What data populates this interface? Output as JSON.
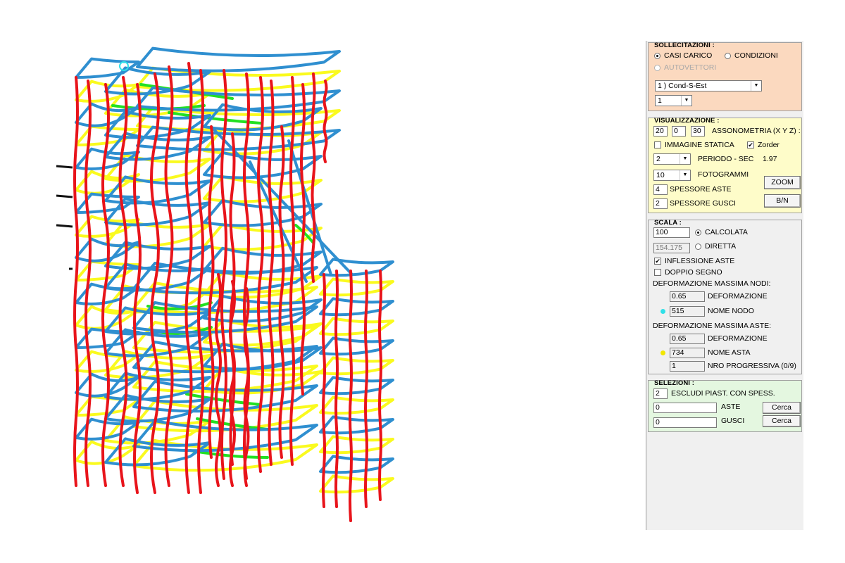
{
  "panel": {
    "sollecitazioni": {
      "title": "SOLLECITAZIONI :",
      "casi_carico": "CASI CARICO",
      "condizioni": "CONDIZIONI",
      "autovettori": "AUTOVETTORI",
      "load_case": "1 ) Cond-S-Est",
      "mode": "1"
    },
    "visualizzazione": {
      "title": "VISUALIZZAZIONE :",
      "ax": "20",
      "ay": "0",
      "az": "30",
      "assonometria": "ASSONOMETRIA (X Y Z) :",
      "immagine_statica": "IMMAGINE STATICA",
      "zorder": "Zorder",
      "periodo_value": "2",
      "periodo_label": "PERIODO - SEC",
      "periodo_sec": "1.97",
      "fotogrammi_value": "10",
      "fotogrammi_label": "FOTOGRAMMI",
      "spessore_aste_value": "4",
      "spessore_aste_label": "SPESSORE ASTE",
      "spessore_gusci_value": "2",
      "spessore_gusci_label": "SPESSORE GUSCI",
      "zoom": "ZOOM",
      "bn": "B/N"
    },
    "scala": {
      "title": "SCALA :",
      "calcolata_value": "100",
      "calcolata": "CALCOLATA",
      "diretta_value": "154.175",
      "diretta": "DIRETTA",
      "inflessione_aste": "INFLESSIONE ASTE",
      "doppio_segno": "DOPPIO SEGNO",
      "def_max_nodi": "DEFORMAZIONE MASSIMA NODI:",
      "nodi_def_value": "0.65",
      "nodi_def_label": "DEFORMAZIONE",
      "nodo_value": "515",
      "nodo_label": "NOME NODO",
      "def_max_aste": "DEFORMAZIONE MASSIMA ASTE:",
      "aste_def_value": "0.65",
      "aste_def_label": "DEFORMAZIONE",
      "asta_value": "734",
      "asta_label": "NOME ASTA",
      "progressiva_value": "1",
      "progressiva_label": "NRO PROGRESSIVA (0/9)"
    },
    "selezioni": {
      "title": "SELEZIONI :",
      "escludi_value": "2",
      "escludi_label": "ESCLUDI PIAST. CON SPESS.",
      "aste_value": "0",
      "aste_label": "ASTE",
      "gusci_value": "0",
      "gusci_label": "GUSCI",
      "cerca": "Cerca"
    }
  },
  "colors": {
    "columns": "#e8141b",
    "beams": "#2f8fd0",
    "slab_edges": "#fafa1e",
    "bracing": "#22e022",
    "sollecitazioni_bg": "#fbd9bf",
    "visualizzazione_bg": "#fefcc9",
    "selezioni_bg": "#e4f7e0",
    "node_marker": "#2fe0e8",
    "asta_marker": "#f2e600"
  }
}
